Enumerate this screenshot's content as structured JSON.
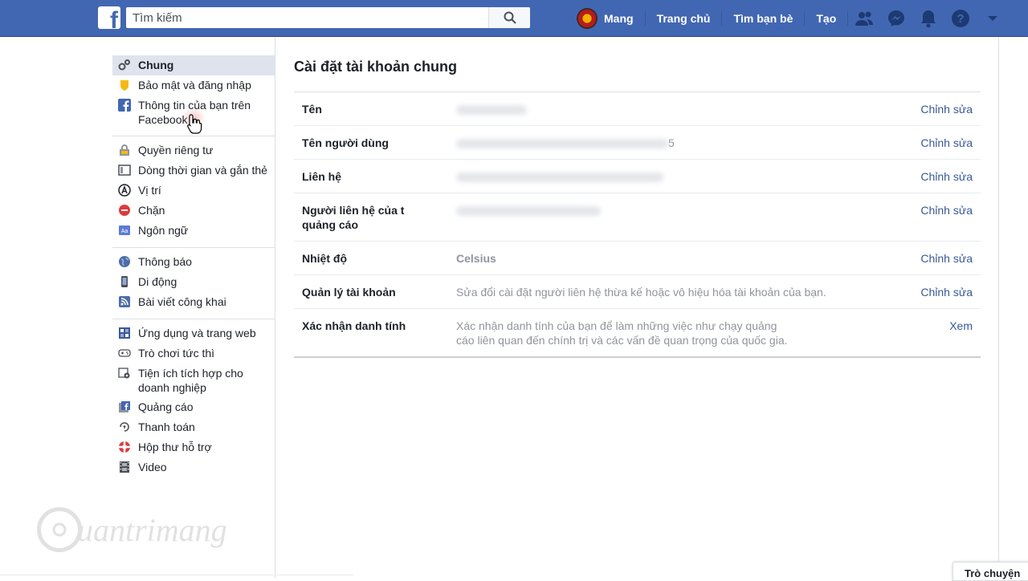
{
  "topbar": {
    "logo": "f",
    "search_placeholder": "Tìm kiếm",
    "user_name": "Mang",
    "home": "Trang chủ",
    "find_friends": "Tìm bạn bè",
    "create": "Tạo",
    "color": "#4267b2"
  },
  "sidebar": {
    "group1": [
      {
        "label": "Chung",
        "icon": "gear-icon"
      },
      {
        "label": "Bảo mật và đăng nhập",
        "icon": "shield-icon"
      },
      {
        "label": "Thông tin của bạn trên Facebook",
        "icon": "facebook-icon"
      }
    ],
    "group2": [
      {
        "label": "Quyền riêng tư",
        "icon": "lock-icon"
      },
      {
        "label": "Dòng thời gian và gắn thẻ",
        "icon": "timeline-icon"
      },
      {
        "label": "Vị trí",
        "icon": "location-icon"
      },
      {
        "label": "Chặn",
        "icon": "block-icon"
      },
      {
        "label": "Ngôn ngữ",
        "icon": "language-icon"
      }
    ],
    "group3": [
      {
        "label": "Thông báo",
        "icon": "globe-icon"
      },
      {
        "label": "Di động",
        "icon": "mobile-icon"
      },
      {
        "label": "Bài viết công khai",
        "icon": "rss-icon"
      }
    ],
    "group4": [
      {
        "label": "Ứng dụng và trang web",
        "icon": "apps-icon"
      },
      {
        "label": "Trò chơi tức thì",
        "icon": "gamepad-icon"
      },
      {
        "label": "Tiện ích tích hợp cho doanh nghiệp",
        "icon": "business-integration-icon"
      },
      {
        "label": "Quảng cáo",
        "icon": "ads-icon"
      },
      {
        "label": "Thanh toán",
        "icon": "payment-icon"
      },
      {
        "label": "Hộp thư hỗ trợ",
        "icon": "lifebuoy-icon"
      },
      {
        "label": "Video",
        "icon": "film-icon"
      }
    ]
  },
  "main": {
    "title": "Cài đặt tài khoản chung",
    "rows": [
      {
        "label": "Tên",
        "value": "",
        "action": "Chỉnh sửa"
      },
      {
        "label": "Tên người dùng",
        "value": "5",
        "action": "Chỉnh sửa"
      },
      {
        "label": "Liên hệ",
        "value": "",
        "action": "Chỉnh sửa"
      },
      {
        "label": "Người liên hệ của t",
        "label2": "quảng cáo",
        "value": "",
        "action": "Chỉnh sửa"
      },
      {
        "label": "Nhiệt độ",
        "value": "Celsius",
        "action": "Chỉnh sửa"
      },
      {
        "label": "Quản lý tài khoản",
        "value": "Sửa đổi cài đặt người liên hệ thừa kế hoặc vô hiệu hóa tài khoản của bạn.",
        "action": "Chỉnh sửa"
      },
      {
        "label": "Xác nhận danh tính",
        "value": "Xác nhận danh tính của bạn để làm những việc như chạy quảng cáo liên quan đến chính trị và các vấn đề quan trọng của quốc gia.",
        "action": "Xem"
      }
    ]
  },
  "watermark": "uantrimang",
  "corner_tab": "Trò chuyện"
}
